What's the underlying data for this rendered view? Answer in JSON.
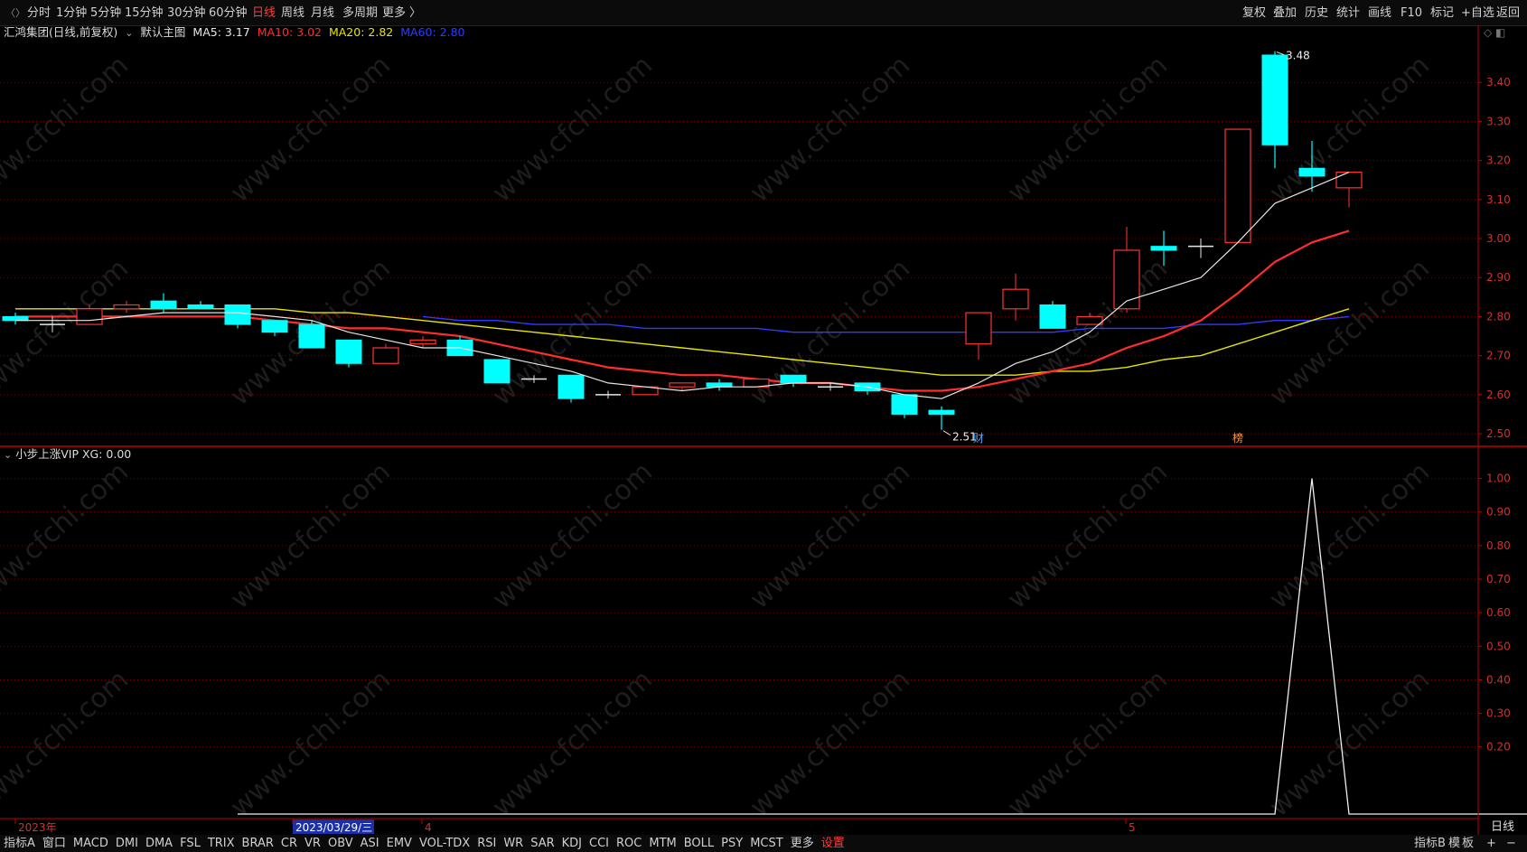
{
  "toolbar_left": [
    "分时",
    "1分钟",
    "5分钟",
    "15分钟",
    "30分钟",
    "60分钟",
    "日线",
    "周线",
    "月线",
    "多周期",
    "更多 〉"
  ],
  "toolbar_left_active": "日线",
  "toolbar_right": [
    "复权",
    "叠加",
    "历史",
    "统计",
    "画线",
    "F10",
    "标记",
    "+自选",
    "返回"
  ],
  "stock": {
    "title": "汇鸿集团(日线,前复权)",
    "subchart_label": "默认主图",
    "ma": [
      {
        "label": "MA5: 3.17",
        "color": "#e6e6e6"
      },
      {
        "label": "MA10: 3.02",
        "color": "#ff2d2d"
      },
      {
        "label": "MA20: 2.82",
        "color": "#e6e600"
      },
      {
        "label": "MA60: 2.80",
        "color": "#2f3bff"
      }
    ]
  },
  "markers": {
    "high": "3.48",
    "low": "2.51",
    "event1": "财",
    "event2": "榜"
  },
  "indicator": {
    "label": "小步上涨VIP",
    "value": "XG: 0.00"
  },
  "xaxis_labels": {
    "year": "2023年",
    "cursor_date": "2023/03/29/三",
    "m4": "4",
    "m5": "5"
  },
  "price_ticks": [
    "3.40",
    "3.30",
    "3.20",
    "3.10",
    "3.00",
    "2.90",
    "2.80",
    "2.70",
    "2.60",
    "2.50"
  ],
  "ind_ticks": [
    "1.00",
    "0.90",
    "0.80",
    "0.70",
    "0.60",
    "0.50",
    "0.40",
    "0.30",
    "0.20"
  ],
  "right_panel_label": "日线",
  "bottom_tabs": [
    "指标A",
    "窗口",
    "MACD",
    "DMI",
    "DMA",
    "FSL",
    "TRIX",
    "BRAR",
    "CR",
    "VR",
    "OBV",
    "ASI",
    "EMV",
    "VOL-TDX",
    "RSI",
    "WR",
    "SAR",
    "KDJ",
    "CCI",
    "ROC",
    "MTM",
    "BOLL",
    "PSY",
    "MCST",
    "更多",
    "设置"
  ],
  "bottom_tab_active": "设置",
  "bottom_right": [
    "指标B",
    "模",
    "板",
    "+",
    "−"
  ],
  "watermark": "www.cfchi.com",
  "colors": {
    "up": "#ff3232",
    "down": "#00ffff",
    "grid": "#7a0000",
    "axis": "#c00000"
  },
  "chart_data": [
    {
      "type": "candlestick",
      "title": "汇鸿集团(日线,前复权)",
      "ylim": [
        2.47,
        3.5
      ],
      "candles": [
        {
          "o": 2.8,
          "h": 2.81,
          "l": 2.78,
          "c": 2.79
        },
        {
          "o": 2.78,
          "h": 2.8,
          "l": 2.76,
          "c": 2.78
        },
        {
          "o": 2.78,
          "h": 2.83,
          "l": 2.78,
          "c": 2.82
        },
        {
          "o": 2.82,
          "h": 2.84,
          "l": 2.81,
          "c": 2.83
        },
        {
          "o": 2.84,
          "h": 2.86,
          "l": 2.81,
          "c": 2.82
        },
        {
          "o": 2.83,
          "h": 2.84,
          "l": 2.82,
          "c": 2.82
        },
        {
          "o": 2.83,
          "h": 2.83,
          "l": 2.77,
          "c": 2.78
        },
        {
          "o": 2.79,
          "h": 2.79,
          "l": 2.75,
          "c": 2.76
        },
        {
          "o": 2.78,
          "h": 2.79,
          "l": 2.72,
          "c": 2.72
        },
        {
          "o": 2.74,
          "h": 2.74,
          "l": 2.67,
          "c": 2.68
        },
        {
          "o": 2.68,
          "h": 2.73,
          "l": 2.68,
          "c": 2.72
        },
        {
          "o": 2.73,
          "h": 2.75,
          "l": 2.72,
          "c": 2.74
        },
        {
          "o": 2.74,
          "h": 2.75,
          "l": 2.7,
          "c": 2.7
        },
        {
          "o": 2.69,
          "h": 2.69,
          "l": 2.63,
          "c": 2.63
        },
        {
          "o": 2.64,
          "h": 2.65,
          "l": 2.63,
          "c": 2.64
        },
        {
          "o": 2.65,
          "h": 2.65,
          "l": 2.58,
          "c": 2.59
        },
        {
          "o": 2.6,
          "h": 2.61,
          "l": 2.59,
          "c": 2.6
        },
        {
          "o": 2.6,
          "h": 2.62,
          "l": 2.6,
          "c": 2.62
        },
        {
          "o": 2.62,
          "h": 2.63,
          "l": 2.61,
          "c": 2.63
        },
        {
          "o": 2.63,
          "h": 2.64,
          "l": 2.61,
          "c": 2.62
        },
        {
          "o": 2.62,
          "h": 2.64,
          "l": 2.62,
          "c": 2.64
        },
        {
          "o": 2.65,
          "h": 2.65,
          "l": 2.62,
          "c": 2.63
        },
        {
          "o": 2.62,
          "h": 2.63,
          "l": 2.61,
          "c": 2.62
        },
        {
          "o": 2.63,
          "h": 2.63,
          "l": 2.6,
          "c": 2.61
        },
        {
          "o": 2.6,
          "h": 2.6,
          "l": 2.54,
          "c": 2.55
        },
        {
          "o": 2.56,
          "h": 2.57,
          "l": 2.51,
          "c": 2.55
        },
        {
          "o": 2.73,
          "h": 2.81,
          "l": 2.69,
          "c": 2.81
        },
        {
          "o": 2.82,
          "h": 2.91,
          "l": 2.79,
          "c": 2.87
        },
        {
          "o": 2.83,
          "h": 2.84,
          "l": 2.77,
          "c": 2.77
        },
        {
          "o": 2.78,
          "h": 2.81,
          "l": 2.78,
          "c": 2.8
        },
        {
          "o": 2.82,
          "h": 3.03,
          "l": 2.81,
          "c": 2.97
        },
        {
          "o": 2.98,
          "h": 3.02,
          "l": 2.93,
          "c": 2.97
        },
        {
          "o": 2.98,
          "h": 3.0,
          "l": 2.95,
          "c": 2.98
        },
        {
          "o": 2.99,
          "h": 3.28,
          "l": 2.99,
          "c": 3.28
        },
        {
          "o": 3.47,
          "h": 3.48,
          "l": 3.18,
          "c": 3.24
        },
        {
          "o": 3.18,
          "h": 3.25,
          "l": 3.12,
          "c": 3.16
        },
        {
          "o": 3.13,
          "h": 3.17,
          "l": 3.08,
          "c": 3.17
        }
      ],
      "ma5": [
        2.79,
        2.79,
        2.79,
        2.8,
        2.81,
        2.81,
        2.81,
        2.8,
        2.79,
        2.76,
        2.74,
        2.72,
        2.72,
        2.7,
        2.68,
        2.66,
        2.63,
        2.62,
        2.61,
        2.62,
        2.62,
        2.63,
        2.63,
        2.62,
        2.6,
        2.59,
        2.63,
        2.68,
        2.71,
        2.76,
        2.84,
        2.87,
        2.9,
        2.99,
        3.09,
        3.13,
        3.17
      ],
      "ma10": [
        2.8,
        2.8,
        2.8,
        2.8,
        2.8,
        2.8,
        2.8,
        2.79,
        2.78,
        2.77,
        2.77,
        2.76,
        2.75,
        2.73,
        2.71,
        2.69,
        2.67,
        2.66,
        2.65,
        2.65,
        2.64,
        2.63,
        2.63,
        2.62,
        2.61,
        2.61,
        2.62,
        2.64,
        2.66,
        2.68,
        2.72,
        2.75,
        2.79,
        2.86,
        2.94,
        2.99,
        3.02
      ],
      "ma20": [
        2.82,
        2.82,
        2.82,
        2.82,
        2.82,
        2.82,
        2.82,
        2.82,
        2.81,
        2.81,
        2.8,
        2.79,
        2.78,
        2.77,
        2.76,
        2.75,
        2.74,
        2.73,
        2.72,
        2.71,
        2.7,
        2.69,
        2.68,
        2.67,
        2.66,
        2.65,
        2.65,
        2.65,
        2.66,
        2.66,
        2.67,
        2.69,
        2.7,
        2.73,
        2.76,
        2.79,
        2.82
      ],
      "ma60_start_index": 11,
      "ma60": [
        2.8,
        2.79,
        2.79,
        2.78,
        2.78,
        2.78,
        2.77,
        2.77,
        2.77,
        2.77,
        2.76,
        2.76,
        2.76,
        2.76,
        2.76,
        2.76,
        2.76,
        2.76,
        2.77,
        2.77,
        2.77,
        2.78,
        2.78,
        2.79,
        2.79,
        2.8
      ]
    },
    {
      "type": "line",
      "title": "小步上涨VIP",
      "series": [
        {
          "name": "XG",
          "start_index": 6,
          "values": [
            0,
            0,
            0,
            0,
            0,
            0,
            0,
            0,
            0,
            0,
            0,
            0,
            0,
            0,
            0,
            0,
            0,
            0,
            0,
            0,
            0,
            0,
            0,
            0,
            0,
            0,
            0,
            0,
            0,
            1,
            0,
            0,
            0,
            0,
            0,
            0,
            0
          ]
        }
      ],
      "ylim": [
        0,
        1.05
      ]
    }
  ]
}
